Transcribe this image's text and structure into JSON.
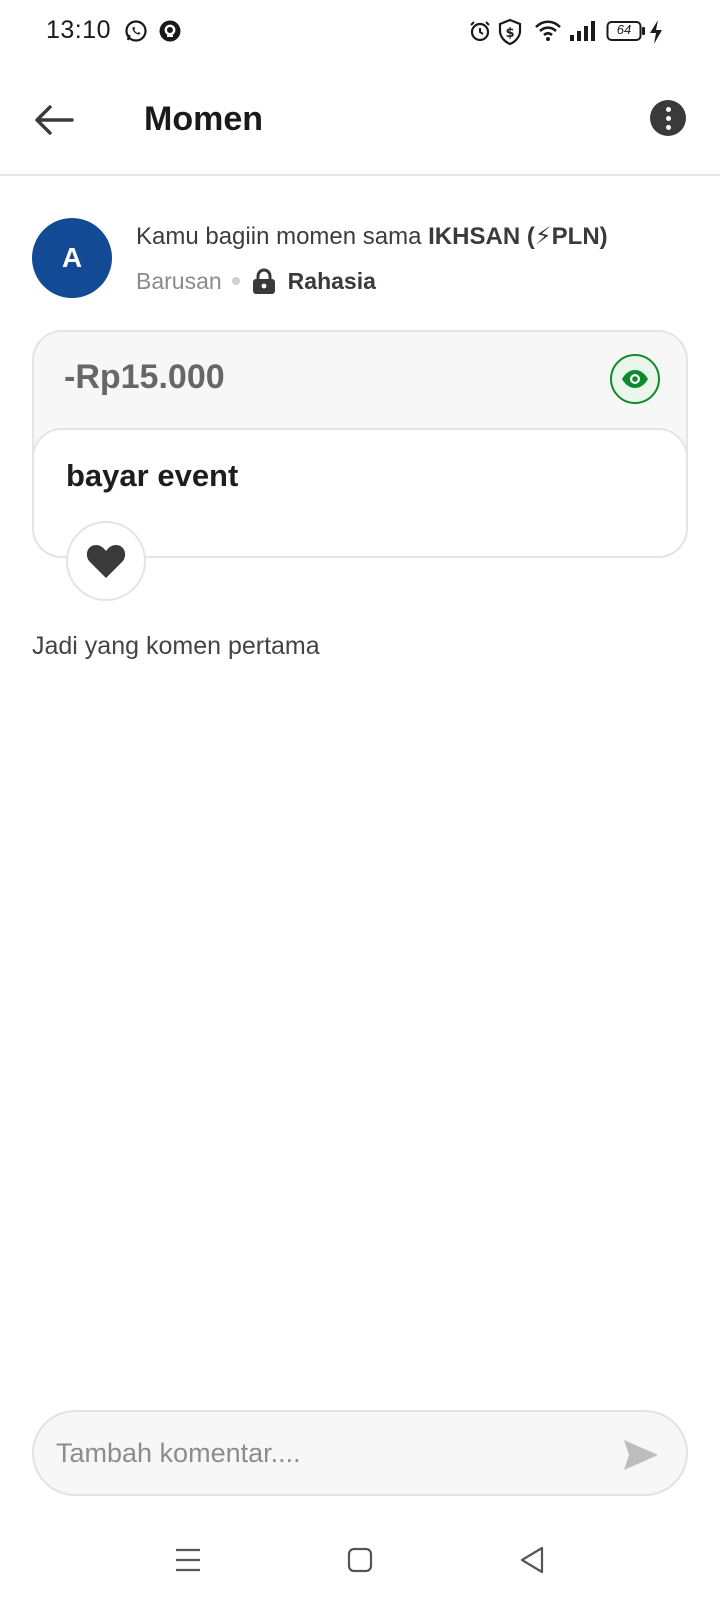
{
  "status_bar": {
    "time": "13:10",
    "battery": "64",
    "left_icons": [
      "whatsapp-icon",
      "app-notification-icon"
    ],
    "right_icons": [
      "alarm-icon",
      "shield-dollar-icon",
      "wifi-icon",
      "signal-icon",
      "battery-icon",
      "charging-icon"
    ]
  },
  "app_bar": {
    "title": "Momen",
    "back_icon": "arrow-left-icon",
    "more_icon": "more-vertical-icon"
  },
  "post": {
    "avatar_initial": "A",
    "share_prefix": "Kamu bagiin momen sama ",
    "share_name": "IKHSAN (⚡PLN)",
    "time_label": "Barusan",
    "privacy_label": "Rahasia",
    "amount": "-Rp15.000",
    "description": "bayar event"
  },
  "comments": {
    "empty_label": "Jadi yang komen pertama",
    "input_placeholder": "Tambah komentar...."
  },
  "colors": {
    "avatar_bg": "#134a96",
    "eye_accent": "#0d8a2e",
    "send_icon": "#bdbdbd"
  }
}
